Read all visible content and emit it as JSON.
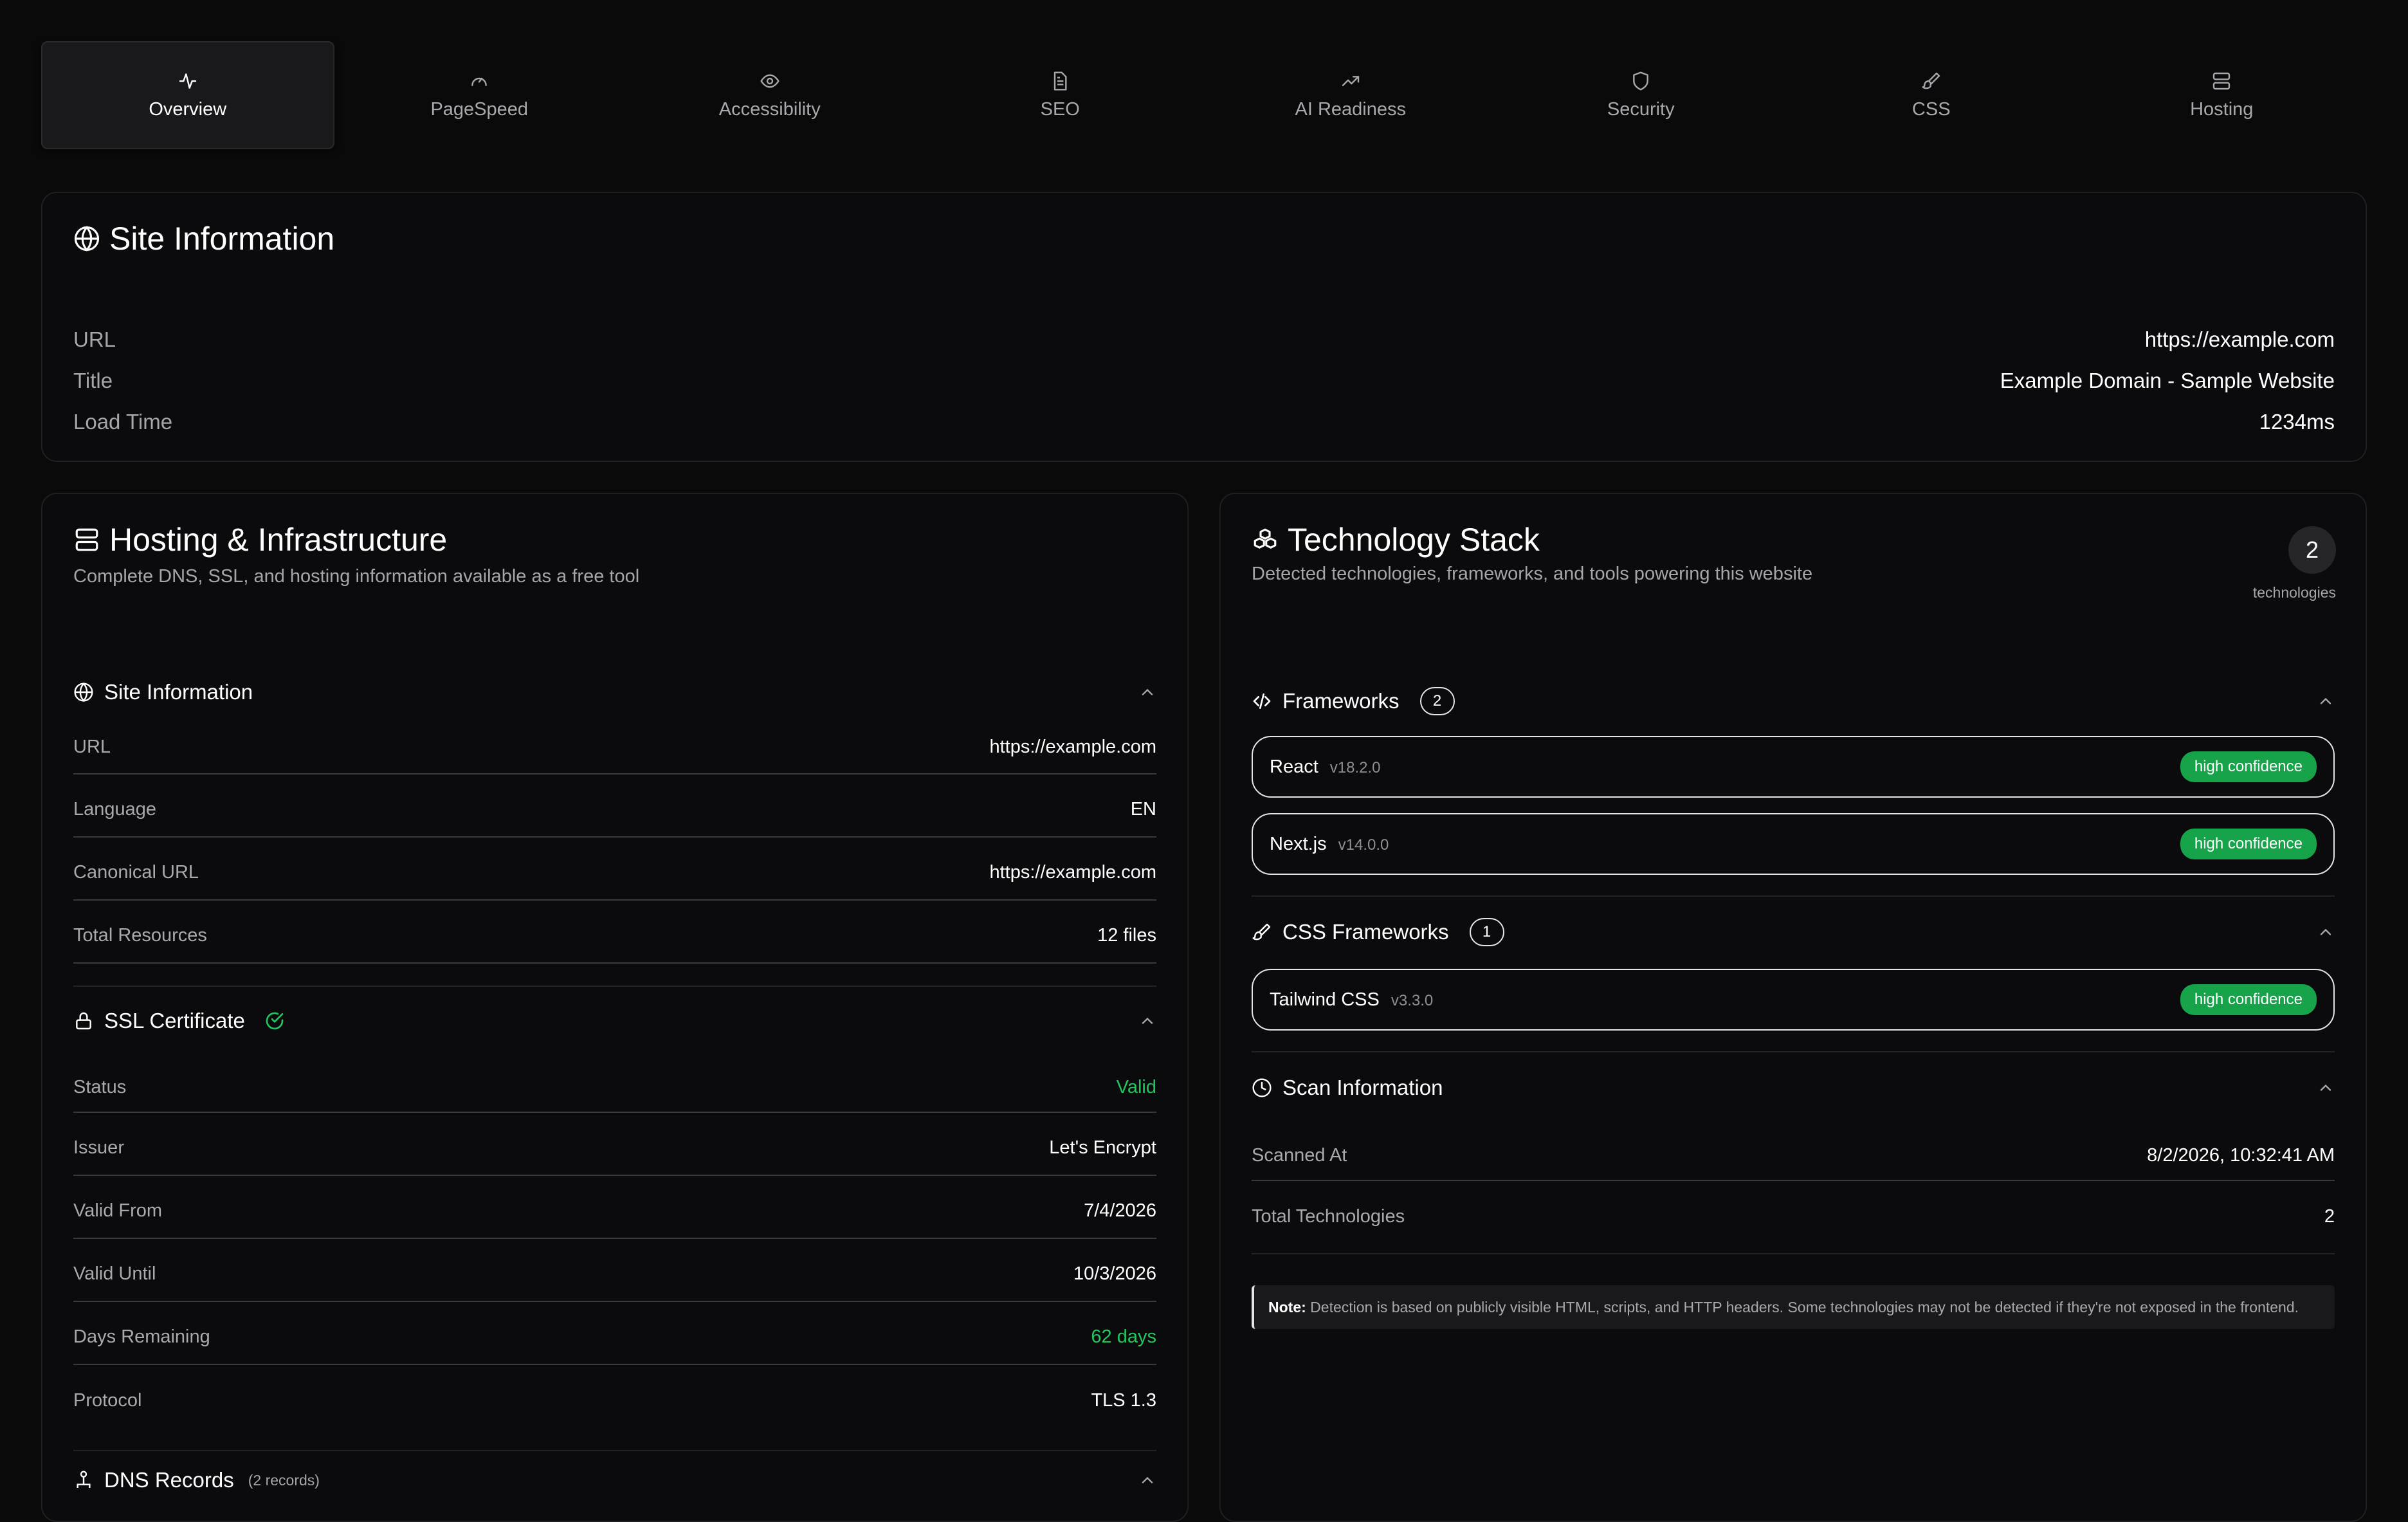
{
  "tabs": [
    {
      "label": "Overview",
      "icon": "activity-icon",
      "active": true
    },
    {
      "label": "PageSpeed",
      "icon": "gauge-icon"
    },
    {
      "label": "Accessibility",
      "icon": "eye-icon"
    },
    {
      "label": "SEO",
      "icon": "file-text-icon"
    },
    {
      "label": "AI Readiness",
      "icon": "trending-up-icon"
    },
    {
      "label": "Security",
      "icon": "shield-icon"
    },
    {
      "label": "CSS",
      "icon": "paintbrush-icon"
    },
    {
      "label": "Hosting",
      "icon": "server-icon"
    }
  ],
  "site_info": {
    "title": "Site Information",
    "rows": [
      {
        "label": "URL",
        "value": "https://example.com"
      },
      {
        "label": "Title",
        "value": "Example Domain - Sample Website"
      },
      {
        "label": "Load Time",
        "value": "1234ms"
      }
    ]
  },
  "hosting": {
    "title": "Hosting & Infrastructure",
    "subtitle": "Complete DNS, SSL, and hosting information available as a free tool",
    "site_section": {
      "title": "Site Information",
      "rows": [
        {
          "label": "URL",
          "value": "https://example.com"
        },
        {
          "label": "Language",
          "value": "EN"
        },
        {
          "label": "Canonical URL",
          "value": "https://example.com"
        },
        {
          "label": "Total Resources",
          "value": "12 files"
        }
      ]
    },
    "ssl_section": {
      "title": "SSL Certificate",
      "rows": [
        {
          "label": "Status",
          "value": "Valid"
        },
        {
          "label": "Issuer",
          "value": "Let's Encrypt"
        },
        {
          "label": "Valid From",
          "value": "7/4/2026"
        },
        {
          "label": "Valid Until",
          "value": "10/3/2026"
        },
        {
          "label": "Days Remaining",
          "value": "62 days"
        },
        {
          "label": "Protocol",
          "value": "TLS 1.3"
        }
      ]
    },
    "dns_section": {
      "title": "DNS Records",
      "count": "(2 records)"
    }
  },
  "tech": {
    "title": "Technology Stack",
    "subtitle": "Detected technologies, frameworks, and tools powering this website",
    "count": "2",
    "count_label": "technologies",
    "frameworks": {
      "title": "Frameworks",
      "count": "2",
      "items": [
        {
          "name": "React",
          "version": "v18.2.0",
          "badge": "high confidence"
        },
        {
          "name": "Next.js",
          "version": "v14.0.0",
          "badge": "high confidence"
        }
      ]
    },
    "css_frameworks": {
      "title": "CSS Frameworks",
      "count": "1",
      "items": [
        {
          "name": "Tailwind CSS",
          "version": "v3.3.0",
          "badge": "high confidence"
        }
      ]
    },
    "scan": {
      "title": "Scan Information",
      "rows": [
        {
          "label": "Scanned At",
          "value": "8/2/2026, 10:32:41 AM"
        },
        {
          "label": "Total Technologies",
          "value": "2"
        }
      ]
    },
    "note_label": "Note:",
    "note_text": "Detection is based on publicly visible HTML, scripts, and HTTP headers. Some technologies may not be detected if they're not exposed in the frontend."
  },
  "colors": {
    "accent_green": "#22c55e",
    "badge_green": "#16a34a",
    "background": "#0a0a0b"
  }
}
